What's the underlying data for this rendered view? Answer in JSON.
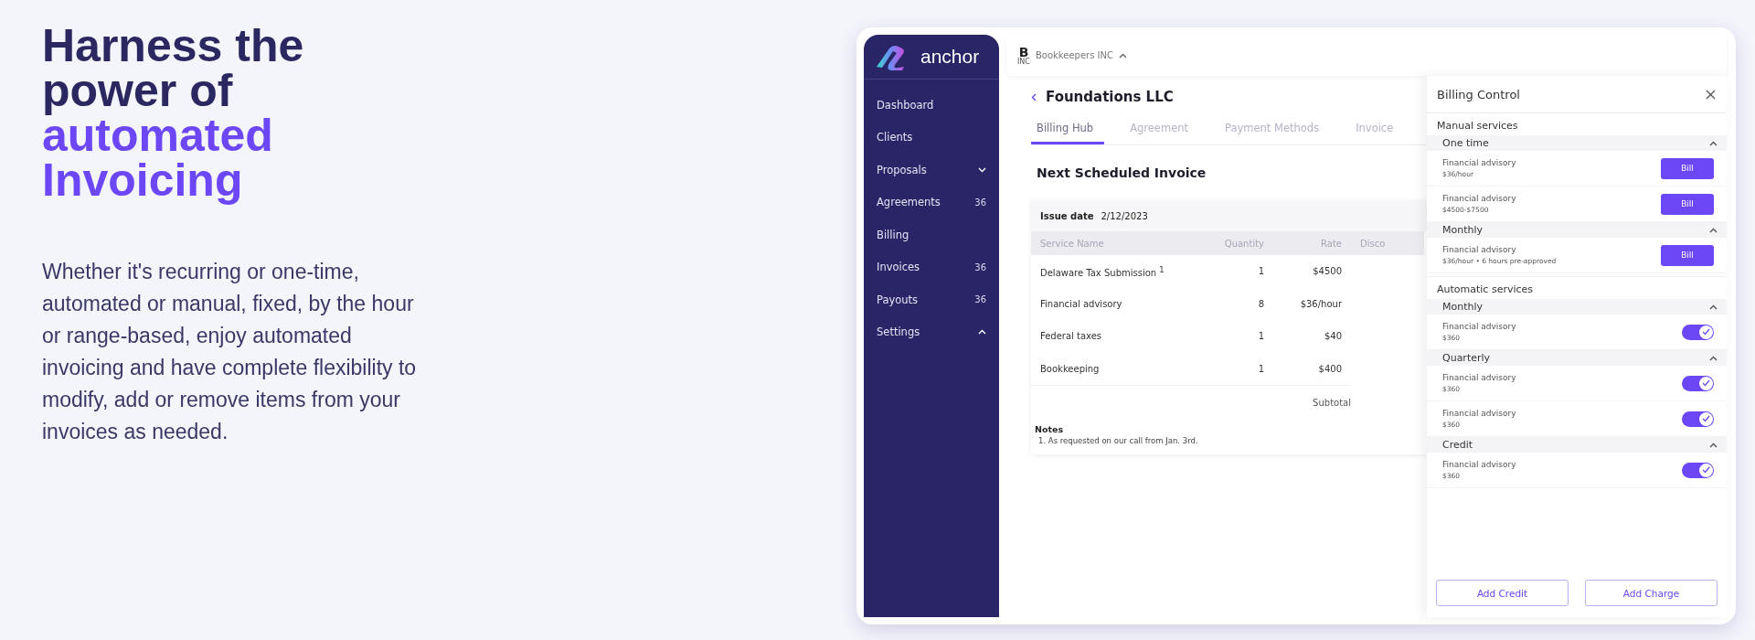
{
  "hero": {
    "heading": [
      {
        "text": "Harness the power of",
        "accent": false
      },
      {
        "text": "automated Invoicing",
        "accent": true
      }
    ],
    "body": "Whether it's recurring or one-time, automated or manual, fixed, by the hour or range-based, enjoy automated invoicing and have complete flexibility to modify, add or remove items from your invoices as needed."
  },
  "app": {
    "brand": "anchor",
    "sidebar": [
      {
        "label": "Dashboard",
        "kind": "link"
      },
      {
        "label": "Clients",
        "kind": "link"
      },
      {
        "label": "Proposals",
        "kind": "group",
        "expanded": false
      },
      {
        "label": "Agreements",
        "kind": "link",
        "badge": "36"
      },
      {
        "label": "Billing",
        "kind": "link"
      },
      {
        "label": "Invoices",
        "kind": "link",
        "badge": "36"
      },
      {
        "label": "Payouts",
        "kind": "link",
        "badge": "36"
      },
      {
        "label": "Settings",
        "kind": "group",
        "expanded": true
      }
    ],
    "org": {
      "logo_letter": "B",
      "logo_sub": "INC",
      "name": "Bookkeepers INC"
    },
    "client": "Foundations LLC",
    "tabs": [
      {
        "label": "Billing Hub",
        "selected": true
      },
      {
        "label": "Agreement",
        "selected": false
      },
      {
        "label": "Payment Methods",
        "selected": false
      },
      {
        "label": "Invoice",
        "selected": false
      }
    ],
    "section_title": "Next Scheduled Invoice",
    "invoice": {
      "issue_label": "Issue date",
      "issue_date": "2/12/2023",
      "columns": [
        "Service Name",
        "Quantity",
        "Rate",
        "Disco"
      ],
      "rows": [
        {
          "service": "Delaware Tax Submission $^{1}$",
          "quantity": "1",
          "rate": "$4500"
        },
        {
          "service": "Financial advisory",
          "quantity": "8",
          "rate": "$36/hour"
        },
        {
          "service": "Federal taxes",
          "quantity": "1",
          "rate": "$40"
        },
        {
          "service": "Bookkeeping",
          "quantity": "1",
          "rate": "$400"
        }
      ],
      "subtotal_label": "Subtotal",
      "notes_title": "Notes",
      "notes": [
        "1. As requested on our call from Jan. 3rd."
      ]
    },
    "billing_control": {
      "title": "Billing Control",
      "sections": [
        {
          "title": "Manual services",
          "groups": [
            {
              "title": "One time",
              "expanded": true,
              "items": [
                {
                  "kind": "bill",
                  "name": "Financial advisory",
                  "price": "$36/hour",
                  "action": "Bill"
                },
                {
                  "kind": "bill",
                  "name": "Financial advisory",
                  "price": "$4500-$7500",
                  "action": "Bill"
                }
              ]
            },
            {
              "title": "Monthly",
              "expanded": true,
              "items": [
                {
                  "kind": "bill",
                  "name": "Financial advisory",
                  "price": "$36/hour • 6 hours pre-approved",
                  "action": "Bill"
                }
              ]
            }
          ]
        },
        {
          "title": "Automatic services",
          "groups": [
            {
              "title": "Monthly",
              "expanded": true,
              "items": [
                {
                  "kind": "toggle",
                  "name": "Financial advisory",
                  "price": "$360",
                  "on": true
                }
              ]
            },
            {
              "title": "Quarterly",
              "expanded": true,
              "items": [
                {
                  "kind": "toggle",
                  "name": "Financial advisory",
                  "price": "$360",
                  "on": true
                },
                {
                  "kind": "toggle",
                  "name": "Financial advisory",
                  "price": "$360",
                  "on": true
                }
              ]
            },
            {
              "title": "Credit",
              "expanded": true,
              "items": [
                {
                  "kind": "toggle",
                  "name": "Financial advisory",
                  "price": "$360",
                  "on": true
                }
              ]
            }
          ]
        }
      ],
      "buttons": [
        "Add Credit",
        "Add Charge"
      ]
    }
  }
}
